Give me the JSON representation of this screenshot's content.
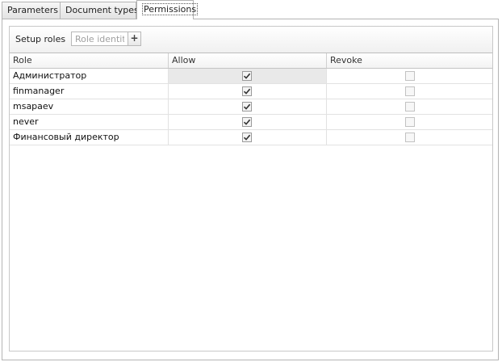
{
  "tabs": [
    {
      "label": "Parameters",
      "active": false
    },
    {
      "label": "Document types",
      "active": false
    },
    {
      "label": "Permissions",
      "active": true
    }
  ],
  "toolbar": {
    "setup_label": "Setup roles",
    "role_placeholder": "Role identity",
    "add_label": "+"
  },
  "grid": {
    "columns": [
      "Role",
      "Allow",
      "Revoke"
    ],
    "rows": [
      {
        "role": "Администратор",
        "allow": true,
        "revoke": false,
        "selected": true
      },
      {
        "role": "finmanager",
        "allow": true,
        "revoke": false,
        "selected": false
      },
      {
        "role": "msapaev",
        "allow": true,
        "revoke": false,
        "selected": false
      },
      {
        "role": "never",
        "allow": true,
        "revoke": false,
        "selected": false
      },
      {
        "role": "Финансовый директор",
        "allow": true,
        "revoke": false,
        "selected": false
      }
    ]
  },
  "icons": {
    "check": "checkmark-icon",
    "add": "plus-icon"
  }
}
